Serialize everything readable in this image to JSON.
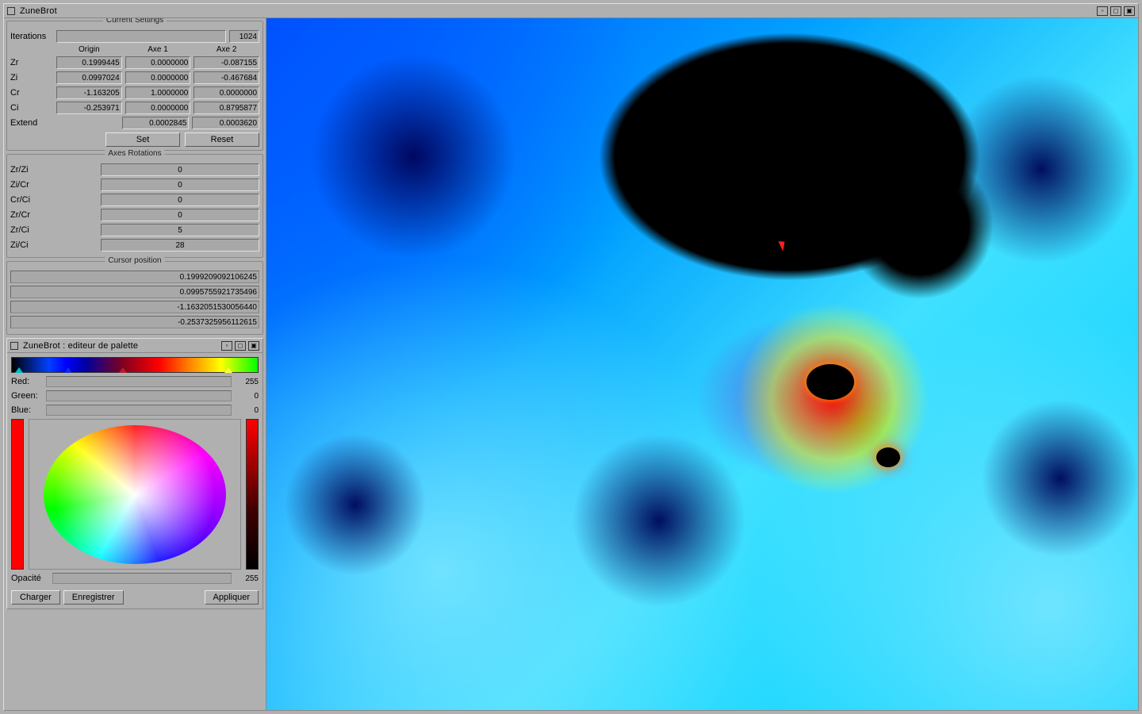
{
  "window": {
    "title": "ZuneBrot"
  },
  "settings": {
    "title": "Current Settings",
    "iterations_label": "Iterations",
    "iterations_value": "1024",
    "headers": {
      "origin": "Origin",
      "axe1": "Axe 1",
      "axe2": "Axe 2"
    },
    "rows": [
      {
        "label": "Zr",
        "origin": "0.1999445",
        "axe1": "0.0000000",
        "axe2": "-0.087155"
      },
      {
        "label": "Zi",
        "origin": "0.0997024",
        "axe1": "0.0000000",
        "axe2": "-0.467684"
      },
      {
        "label": "Cr",
        "origin": "-1.163205",
        "axe1": "1.0000000",
        "axe2": "0.0000000"
      },
      {
        "label": "Ci",
        "origin": "-0.253971",
        "axe1": "0.0000000",
        "axe2": "0.8795877"
      },
      {
        "label": "Extend",
        "origin": "",
        "axe1": "0.0002845",
        "axe2": "0.0003620"
      }
    ],
    "set_label": "Set",
    "reset_label": "Reset"
  },
  "rotations": {
    "title": "Axes Rotations",
    "rows": [
      {
        "label": "Zr/Zi",
        "value": "0"
      },
      {
        "label": "Zi/Cr",
        "value": "0"
      },
      {
        "label": "Cr/Ci",
        "value": "0"
      },
      {
        "label": "Zr/Cr",
        "value": "0"
      },
      {
        "label": "Zr/Ci",
        "value": "5"
      },
      {
        "label": "Zi/Ci",
        "value": "28"
      }
    ]
  },
  "cursor": {
    "title": "Cursor position",
    "values": [
      "0.1999209092106245",
      "0.0995755921735496",
      "-1.1632051530056440",
      "-0.2537325956112615"
    ]
  },
  "palette": {
    "window_title": "ZuneBrot : editeur de palette",
    "red_label": "Red:",
    "red_value": "255",
    "green_label": "Green:",
    "green_value": "0",
    "blue_label": "Blue:",
    "blue_value": "0",
    "opacity_label": "Opacité",
    "opacity_value": "255",
    "load_label": "Charger",
    "save_label": "Enregistrer",
    "apply_label": "Appliquer",
    "markers": [
      {
        "pos": 3,
        "color": "#00c0c0"
      },
      {
        "pos": 23,
        "color": "#1030d0"
      },
      {
        "pos": 45,
        "color": "#b02030"
      },
      {
        "pos": 88,
        "color": "#ffff40"
      }
    ]
  }
}
